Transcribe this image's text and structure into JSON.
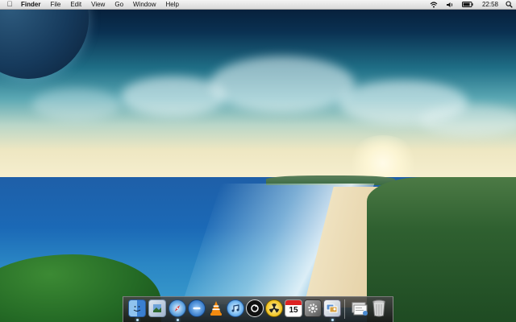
{
  "menubar": {
    "apple_icon": "apple-icon",
    "items": [
      "Finder",
      "File",
      "Edit",
      "View",
      "Go",
      "Window",
      "Help"
    ],
    "status": {
      "wifi_icon": "wifi-icon",
      "volume_icon": "volume-icon",
      "battery_icon": "battery-icon",
      "clock": "22:58",
      "spotlight_icon": "spotlight-search-icon"
    }
  },
  "wallpaper": {
    "description_icon": "coastline-wallpaper"
  },
  "dock": {
    "items": [
      {
        "icon": "finder-icon",
        "running": true
      },
      {
        "icon": "preview-icon",
        "running": false
      },
      {
        "icon": "safari-icon",
        "running": true
      },
      {
        "icon": "itunes-remote-icon",
        "running": false
      },
      {
        "icon": "vlc-icon",
        "running": false
      },
      {
        "icon": "itunes-icon",
        "running": false
      },
      {
        "icon": "utilities-icon",
        "running": false
      },
      {
        "icon": "radioactive-app-icon",
        "running": false
      },
      {
        "icon": "calendar-icon",
        "running": false,
        "label": "15"
      },
      {
        "icon": "system-preferences-icon",
        "running": false
      },
      {
        "icon": "photo-app-icon",
        "running": true
      },
      {
        "icon": "documents-stack-icon",
        "running": false
      },
      {
        "icon": "trash-icon",
        "running": false
      }
    ]
  },
  "colors": {
    "menubar_bg": "#e6e6e6",
    "dock_indicator": "#bfe4ff"
  }
}
